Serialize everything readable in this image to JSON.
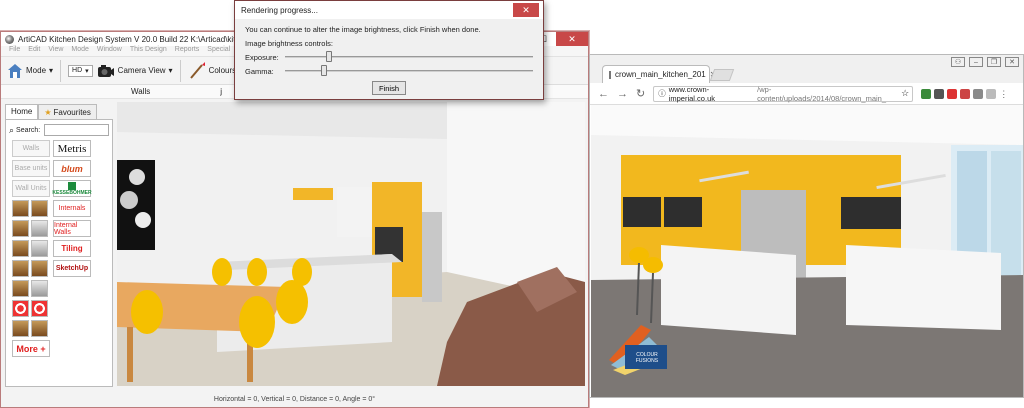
{
  "articad": {
    "title": "ArtiCAD Kitchen  Design System  V 20.0 Build 22  K:\\Articad\\kitchen\\plans\\",
    "menu": [
      "File",
      "Edit",
      "View",
      "Mode",
      "Window",
      "This Design",
      "Reports",
      "Special",
      "He"
    ],
    "toolbar": {
      "mode_label": "Mode",
      "hd_value": "HD",
      "camera_label": "Camera View",
      "colours_label": "Colours"
    },
    "viewbar": {
      "walls_label": "Walls",
      "j_label": "j"
    },
    "left_panel": {
      "tab_home": "Home",
      "tab_favourites": "Favourites",
      "search_label": "Search:",
      "buttons": {
        "walls": "Walls",
        "base_units": "Base units",
        "wall_units": "Wall Units",
        "metris": "Metris",
        "blum": "blum",
        "kessebohmer": "KESSEBÖHMER",
        "internals": "Internals",
        "internal_walls": "Internal Walls",
        "tiling": "Tiling",
        "sketchup": "SketchUp",
        "filler": "Filler",
        "more": "More +"
      }
    },
    "status": "Horizontal = 0, Vertical = 0, Distance = 0, Angle = 0°"
  },
  "dialog": {
    "title": "Rendering progress...",
    "message": "You can continue to alter the image brightness, click Finish when done.",
    "controls_label": "Image brightness controls:",
    "exposure_label": "Exposure:",
    "gamma_label": "Gamma:",
    "exposure_value": 0.18,
    "gamma_value": 0.16,
    "finish_label": "Finish"
  },
  "browser": {
    "tab_title": "crown_main_kitchen_201",
    "url_domain": "www.crown-imperial.co.uk",
    "url_path": "/wp-content/uploads/2014/08/crown_main_",
    "colour_fusions_label": "COLOUR FUSIONS"
  }
}
